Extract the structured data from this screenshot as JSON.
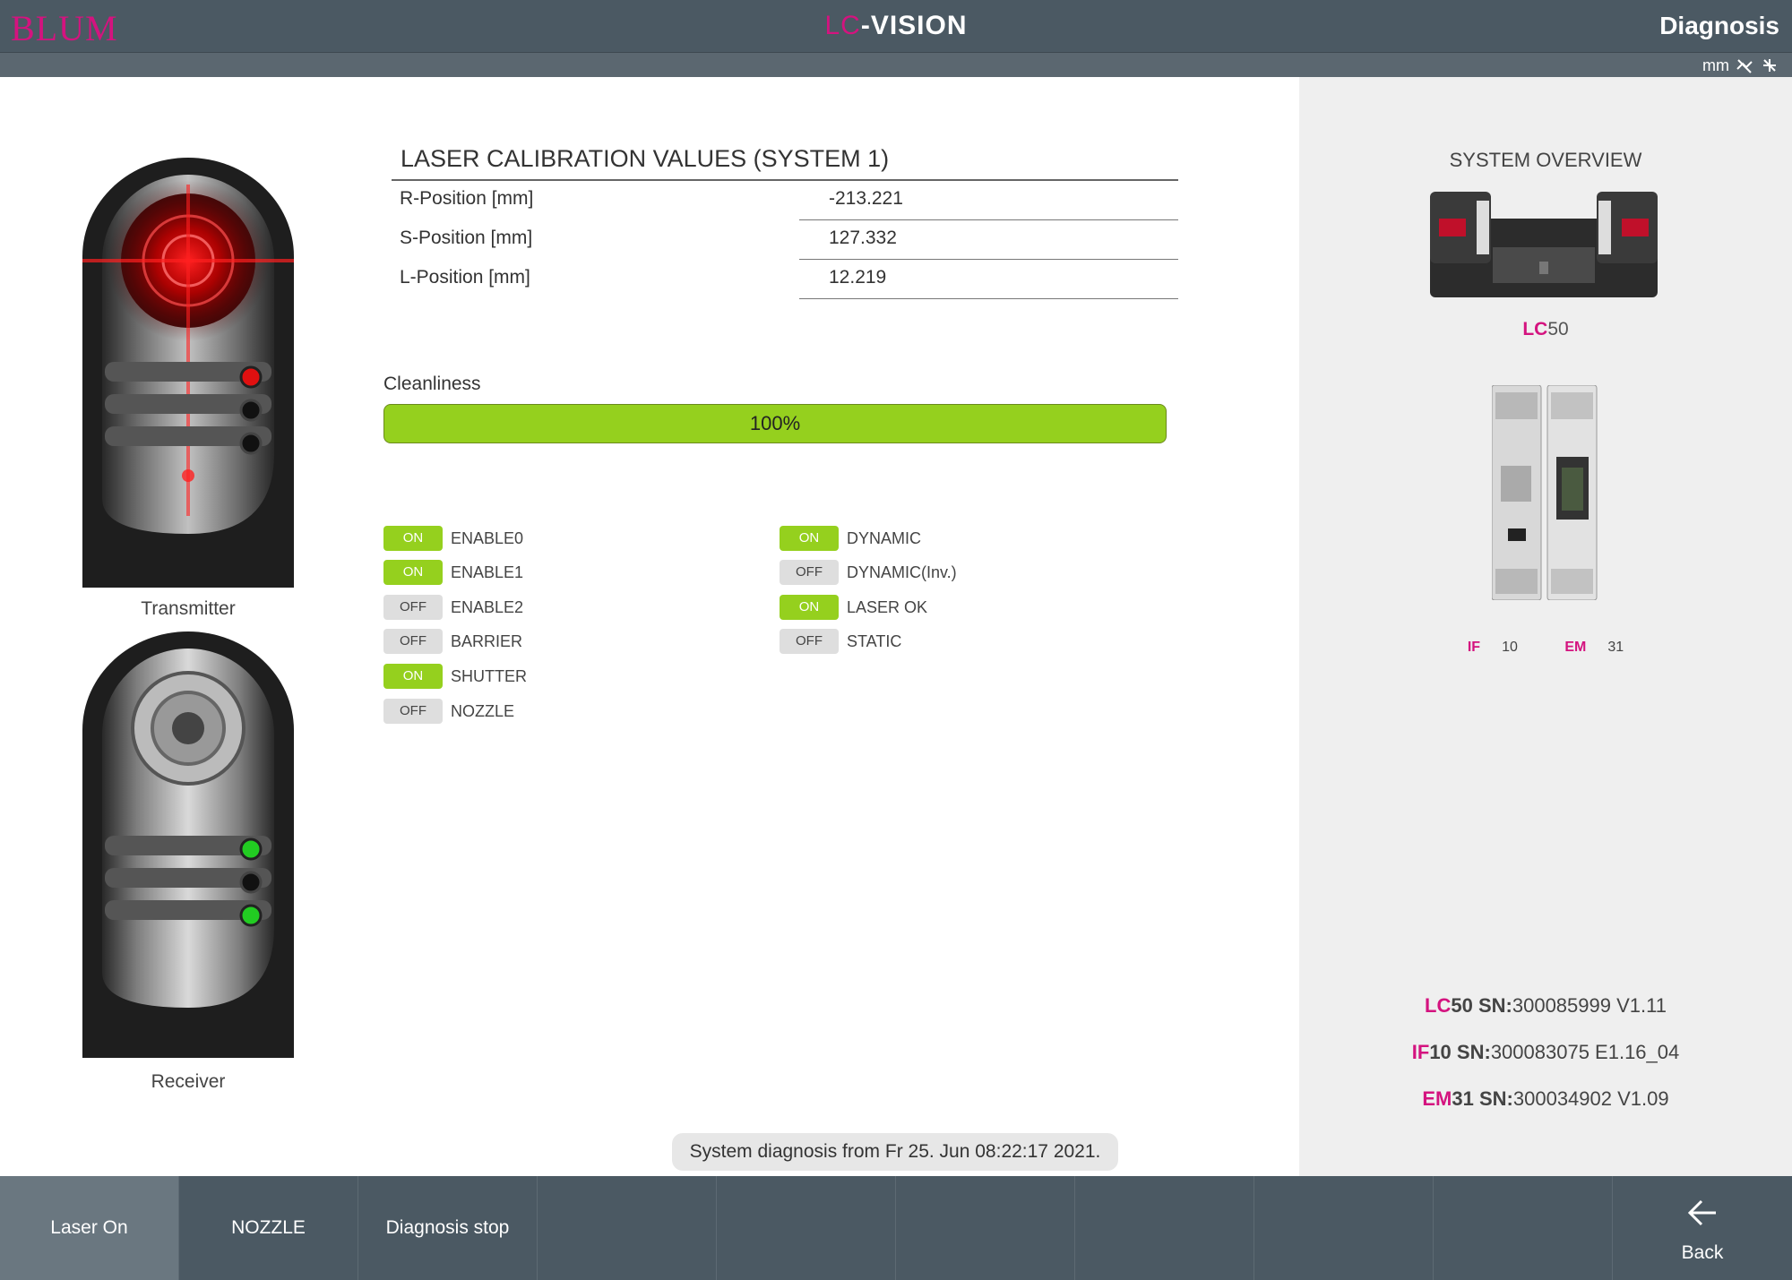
{
  "header": {
    "logo": "BLUM",
    "app_title_accent": "LC",
    "app_title_rest": "-VISION",
    "page_title": "Diagnosis",
    "unit": "mm"
  },
  "sensors": {
    "transmitter_label": "Transmitter",
    "receiver_label": "Receiver"
  },
  "calibration": {
    "title": "LASER CALIBRATION VALUES (SYSTEM 1)",
    "rows": [
      {
        "label": "R-Position [mm]",
        "value": "-213.221"
      },
      {
        "label": "S-Position [mm]",
        "value": "127.332"
      },
      {
        "label": "L-Position [mm]",
        "value": "12.219"
      }
    ]
  },
  "cleanliness": {
    "label": "Cleanliness",
    "value_text": "100%",
    "value": 1.0
  },
  "status_left": [
    {
      "state": "ON",
      "name": "ENABLE0"
    },
    {
      "state": "ON",
      "name": "ENABLE1"
    },
    {
      "state": "OFF",
      "name": "ENABLE2"
    },
    {
      "state": "OFF",
      "name": "BARRIER"
    },
    {
      "state": "ON",
      "name": "SHUTTER"
    },
    {
      "state": "OFF",
      "name": "NOZZLE"
    }
  ],
  "status_right": [
    {
      "state": "ON",
      "name": "DYNAMIC"
    },
    {
      "state": "OFF",
      "name": "DYNAMIC(Inv.)"
    },
    {
      "state": "ON",
      "name": "LASER OK"
    },
    {
      "state": "OFF",
      "name": "STATIC"
    }
  ],
  "overview": {
    "title": "SYSTEM OVERVIEW",
    "lc_prefix": "LC",
    "lc_model": "50",
    "if_prefix": "IF",
    "if_model": "10",
    "em_prefix": "EM",
    "em_model": "31",
    "serials": [
      {
        "prefix": "LC",
        "model": "50",
        "sn_label": "SN:",
        "sn": "300085999 V1.11"
      },
      {
        "prefix": "IF",
        "model": "10",
        "sn_label": "SN:",
        "sn": "300083075 E1.16_04"
      },
      {
        "prefix": "EM",
        "model": "31",
        "sn_label": "SN:",
        "sn": "300034902 V1.09"
      }
    ]
  },
  "diagnosis_message": "System diagnosis from Fr 25. Jun 08:22:17 2021.",
  "toolbar": {
    "laser_on": "Laser On",
    "nozzle": "NOZZLE",
    "diagnosis_stop": "Diagnosis stop",
    "back": "Back"
  },
  "colors": {
    "accent": "#d4137f",
    "on_green": "#95d01e",
    "bar_dark": "#4b5963",
    "led_red": "#e01010",
    "led_green": "#22cc22"
  }
}
